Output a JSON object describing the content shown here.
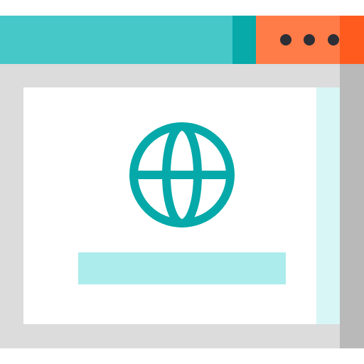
{
  "icon": {
    "name": "browser-window-globe-icon",
    "colors": {
      "titlebar": "#46c8c8",
      "titlebar_accent": "#07a9a9",
      "controls_bg": "#ff7c48",
      "controls_end": "#ff5b1f",
      "dots": "#2e2e36",
      "frame": "#dcdcdc",
      "frame_shadow": "#b9b9b9",
      "content": "#ffffff",
      "content_strip": "#d8f6f5",
      "globe": "#06a9a9",
      "bar": "#acecec"
    },
    "controls": {
      "icon_name": "more-dots-icon",
      "dot_count": 3
    },
    "globe_icon": "globe-icon",
    "placeholder_bar": "text-placeholder-bar"
  }
}
